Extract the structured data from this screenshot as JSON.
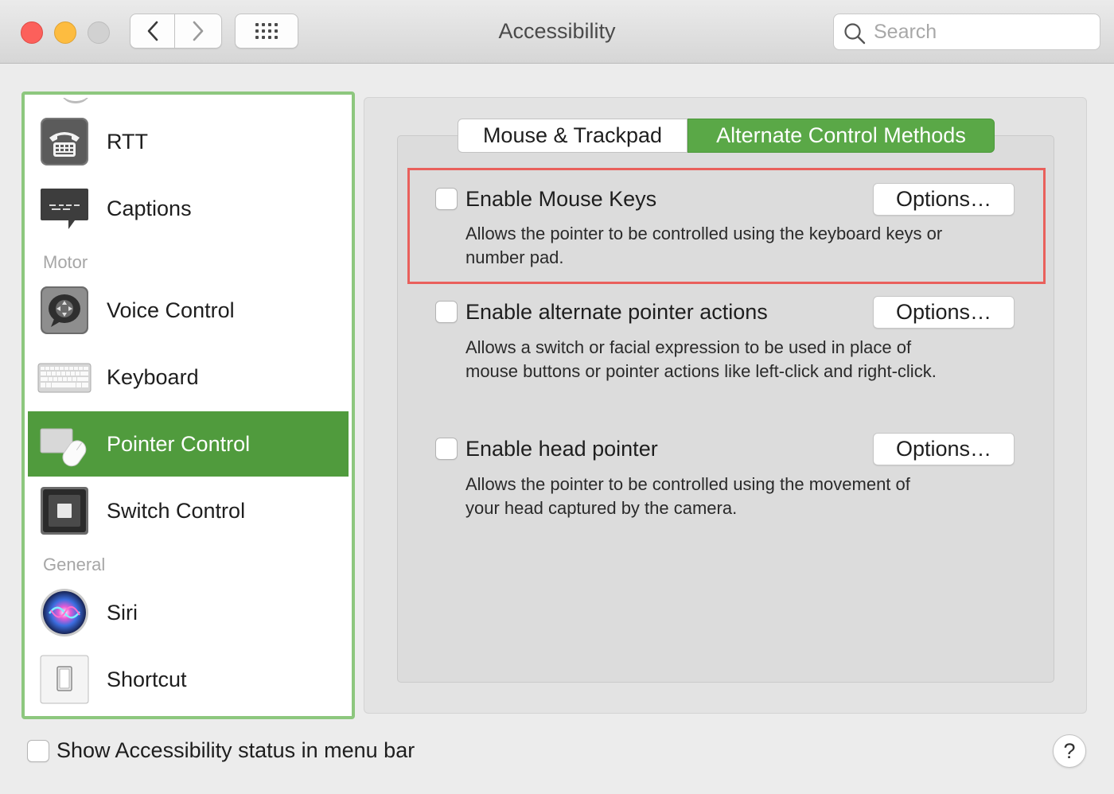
{
  "window": {
    "title": "Accessibility"
  },
  "search": {
    "placeholder": "Search",
    "value": ""
  },
  "sidebar": {
    "items": [
      {
        "label": "RTT",
        "icon": "rtt-phone-icon"
      },
      {
        "label": "Captions",
        "icon": "captions-icon"
      },
      {
        "label": "Voice Control",
        "icon": "voice-control-icon"
      },
      {
        "label": "Keyboard",
        "icon": "keyboard-icon"
      },
      {
        "label": "Pointer Control",
        "icon": "pointer-control-icon",
        "selected": true
      },
      {
        "label": "Switch Control",
        "icon": "switch-control-icon"
      },
      {
        "label": "Siri",
        "icon": "siri-icon"
      },
      {
        "label": "Shortcut",
        "icon": "shortcut-icon"
      }
    ],
    "sections": {
      "motor": "Motor",
      "general": "General"
    }
  },
  "tabs": [
    {
      "label": "Mouse & Trackpad",
      "active": false
    },
    {
      "label": "Alternate Control Methods",
      "active": true
    }
  ],
  "options": [
    {
      "title": "Enable Mouse Keys",
      "checked": false,
      "description": "Allows the pointer to be controlled using the keyboard keys or number pad.",
      "button": "Options…",
      "highlighted": true
    },
    {
      "title": "Enable alternate pointer actions",
      "checked": false,
      "description": "Allows a switch or facial expression to be used in place of mouse buttons or pointer actions like left-click and right-click.",
      "button": "Options…"
    },
    {
      "title": "Enable head pointer",
      "checked": false,
      "description": "Allows the pointer to be controlled using the movement of your head captured by the camera.",
      "button": "Options…"
    }
  ],
  "footer": {
    "status_label": "Show Accessibility status in menu bar",
    "status_checked": false,
    "help": "?"
  },
  "colors": {
    "accent": "#509b3d",
    "sidebar_border": "#8dc77e",
    "highlight": "#e9605c",
    "close": "#fc605b",
    "minimize": "#fdbc40"
  }
}
